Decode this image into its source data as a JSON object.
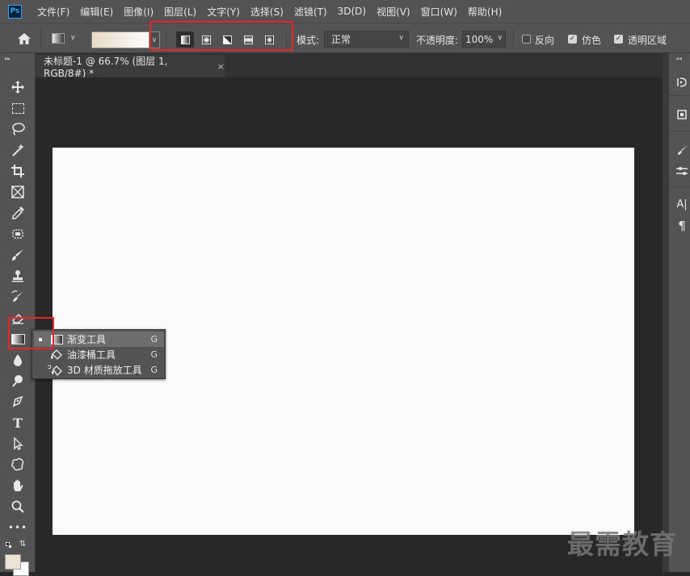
{
  "app": {
    "logo": "Ps"
  },
  "menubar": {
    "items": [
      "文件(F)",
      "编辑(E)",
      "图像(I)",
      "图层(L)",
      "文字(Y)",
      "选择(S)",
      "滤镜(T)",
      "3D(D)",
      "视图(V)",
      "窗口(W)",
      "帮助(H)"
    ]
  },
  "options": {
    "home_icon": "home-icon",
    "gradient_types": [
      "linear-gradient-icon",
      "radial-gradient-icon",
      "angle-gradient-icon",
      "reflected-gradient-icon",
      "diamond-gradient-icon"
    ],
    "mode_label": "模式:",
    "mode_value": "正常",
    "opacity_label": "不透明度:",
    "opacity_value": "100%",
    "reverse_label": "反向",
    "reverse_checked": false,
    "dither_label": "仿色",
    "dither_checked": true,
    "transparency_label": "透明区域",
    "transparency_checked": true,
    "check_mark": "✓",
    "gradient_colors": [
      "#e8dac4",
      "#ffffff"
    ]
  },
  "document": {
    "tab_title": "未标题-1 @ 66.7% (图层 1, RGB/8#) *",
    "close_glyph": "×"
  },
  "toolbar": {
    "tools": [
      "move-tool-icon",
      "marquee-tool-icon",
      "lasso-tool-icon",
      "magic-wand-icon",
      "crop-tool-icon",
      "frame-tool-icon",
      "eyedropper-icon",
      "healing-brush-icon",
      "brush-tool-icon",
      "clone-stamp-icon",
      "history-brush-icon",
      "eraser-icon",
      "gradient-tool-icon",
      "blur-tool-icon",
      "dodge-tool-icon",
      "pen-tool-icon",
      "type-tool-icon",
      "path-selection-icon",
      "shape-tool-icon",
      "hand-tool-icon",
      "zoom-tool-icon",
      "more-tools-icon"
    ],
    "type_glyph": "T",
    "more_glyph": "•••"
  },
  "flyout": {
    "items": [
      {
        "label": "渐变工具",
        "shortcut": "G",
        "icon": "gradient-icon",
        "selected": true
      },
      {
        "label": "油漆桶工具",
        "shortcut": "G",
        "icon": "paint-bucket-icon",
        "selected": false
      },
      {
        "label": "3D 材质拖放工具",
        "shortcut": "G",
        "icon": "3d-material-drop-icon",
        "selected": false
      }
    ]
  },
  "right_panel": {
    "text_glyph": "A|",
    "paragraph_glyph": "¶"
  },
  "colors": {
    "foreground": "#ece4d4",
    "background": "#ffffff",
    "highlight": "#e8242c",
    "canvas": "#fbfbfb"
  },
  "watermark": "最需教育"
}
